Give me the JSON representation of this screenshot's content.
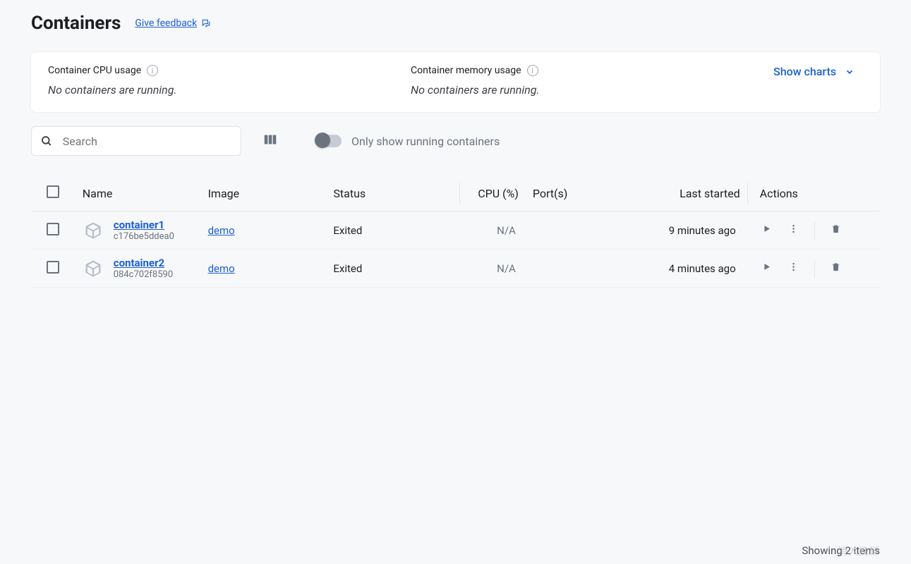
{
  "header": {
    "title": "Containers",
    "feedback_label": "Give feedback"
  },
  "stats": {
    "cpu_label": "Container CPU usage",
    "memory_label": "Container memory usage",
    "empty_message": "No containers are running.",
    "show_charts_label": "Show charts"
  },
  "toolbar": {
    "search_placeholder": "Search",
    "toggle_label": "Only show running containers",
    "toggle_on": false
  },
  "table": {
    "columns": {
      "name": "Name",
      "image": "Image",
      "status": "Status",
      "cpu": "CPU (%)",
      "ports": "Port(s)",
      "last_started": "Last started",
      "actions": "Actions"
    },
    "rows": [
      {
        "name": "container1",
        "hash": "c176be5ddea0",
        "image": "demo",
        "status": "Exited",
        "cpu": "N/A",
        "ports": "",
        "last_started": "9 minutes ago"
      },
      {
        "name": "container2",
        "hash": "084c702f8590",
        "image": "demo",
        "status": "Exited",
        "cpu": "N/A",
        "ports": "",
        "last_started": "4 minutes ago"
      }
    ]
  },
  "footer": {
    "showing": "Showing 2 items"
  },
  "watermark": "消入挽醉"
}
